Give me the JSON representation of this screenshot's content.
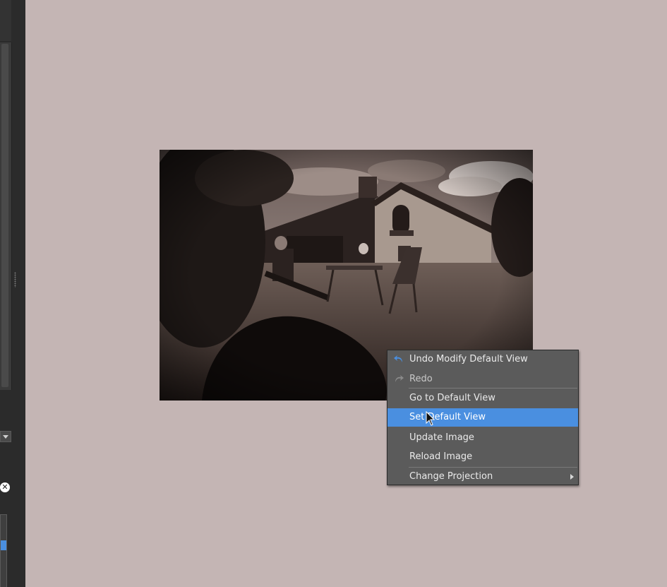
{
  "left_panel": {
    "close_icon_glyph": "✕"
  },
  "viewport": {
    "background": "#c4b5b4"
  },
  "context_menu": {
    "items": [
      {
        "label": "Undo Modify Default View",
        "icon": "undo-icon",
        "enabled": true
      },
      {
        "label": "Redo",
        "icon": "redo-icon",
        "enabled": false
      },
      {
        "label": "Go to Default View",
        "enabled": true
      },
      {
        "label": "Set Default View",
        "enabled": true,
        "highlighted": true
      },
      {
        "label": "Update Image",
        "enabled": true
      },
      {
        "label": "Reload Image",
        "enabled": true
      },
      {
        "label": "Change Projection",
        "enabled": true,
        "submenu": true
      }
    ],
    "highlight_color": "#4a8fe0"
  }
}
